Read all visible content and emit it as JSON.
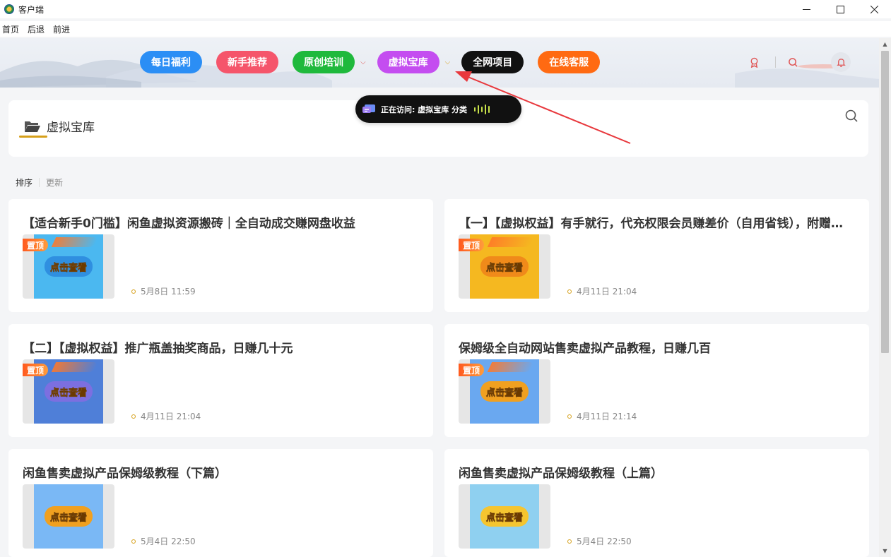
{
  "window": {
    "title": "客户端"
  },
  "menu": {
    "items": [
      "首页",
      "后退",
      "前进"
    ]
  },
  "nav": {
    "buttons": [
      {
        "label": "每日福利",
        "color": "#2b8ef5",
        "caret": false
      },
      {
        "label": "新手推荐",
        "color": "#f5556b",
        "caret": false
      },
      {
        "label": "原创培训",
        "color": "#1fb93c",
        "caret": true,
        "caret_color": "#e05555"
      },
      {
        "label": "虚拟宝库",
        "color": "#c44df0",
        "caret": true,
        "caret_color": "#d6a01a"
      },
      {
        "label": "全网项目",
        "color": "#111111",
        "caret": false
      },
      {
        "label": "在线客服",
        "color": "#ff6a12",
        "caret": false
      }
    ]
  },
  "header_icons": [
    "award-icon",
    "search-icon",
    "bell-icon"
  ],
  "visit": {
    "text": "正在访问: 虚拟宝库 分类"
  },
  "category": {
    "title": "虚拟宝库"
  },
  "sort": {
    "label": "排序",
    "option": "更新"
  },
  "posts": [
    {
      "title": "【适合新手0门槛】闲鱼虚拟资源搬砖｜全自动成交赚网盘收益",
      "date": "5月8日 11:59",
      "pinned": true,
      "pin_label": "置顶",
      "thumb_label": "点击查看",
      "thumb_bg": "#4bb8f0",
      "btn_bg": "#2f8fe0"
    },
    {
      "title": "【一】【虚拟权益】有手就行，代充权限会员赚差价（自用省钱），附赠完整代充渠道",
      "date": "4月11日 21:04",
      "pinned": true,
      "pin_label": "置顶",
      "thumb_label": "点击查看",
      "thumb_bg": "#f5b820",
      "btn_bg": "#f08a1a"
    },
    {
      "title": "【二】【虚拟权益】推广瓶盖抽奖商品，日赚几十元",
      "date": "4月11日 21:04",
      "pinned": true,
      "pin_label": "置顶",
      "thumb_label": "点击查看",
      "thumb_bg": "#4f7fd8",
      "btn_bg": "#7c6fe0"
    },
    {
      "title": "保姆级全自动网站售卖虚拟产品教程，日赚几百",
      "date": "4月11日 21:14",
      "pinned": true,
      "pin_label": "置顶",
      "thumb_label": "点击查看",
      "thumb_bg": "#6aa8f0",
      "btn_bg": "#f0a020"
    },
    {
      "title": "闲鱼售卖虚拟产品保姆级教程（下篇）",
      "date": "5月4日 22:50",
      "pinned": false,
      "pin_label": "",
      "thumb_label": "点击查看",
      "thumb_bg": "#7ab8f5",
      "btn_bg": "#f0a020"
    },
    {
      "title": "闲鱼售卖虚拟产品保姆级教程（上篇）",
      "date": "5月4日 22:50",
      "pinned": false,
      "pin_label": "",
      "thumb_label": "点击查看",
      "thumb_bg": "#8fd0f0",
      "btn_bg": "#f5c530"
    }
  ]
}
